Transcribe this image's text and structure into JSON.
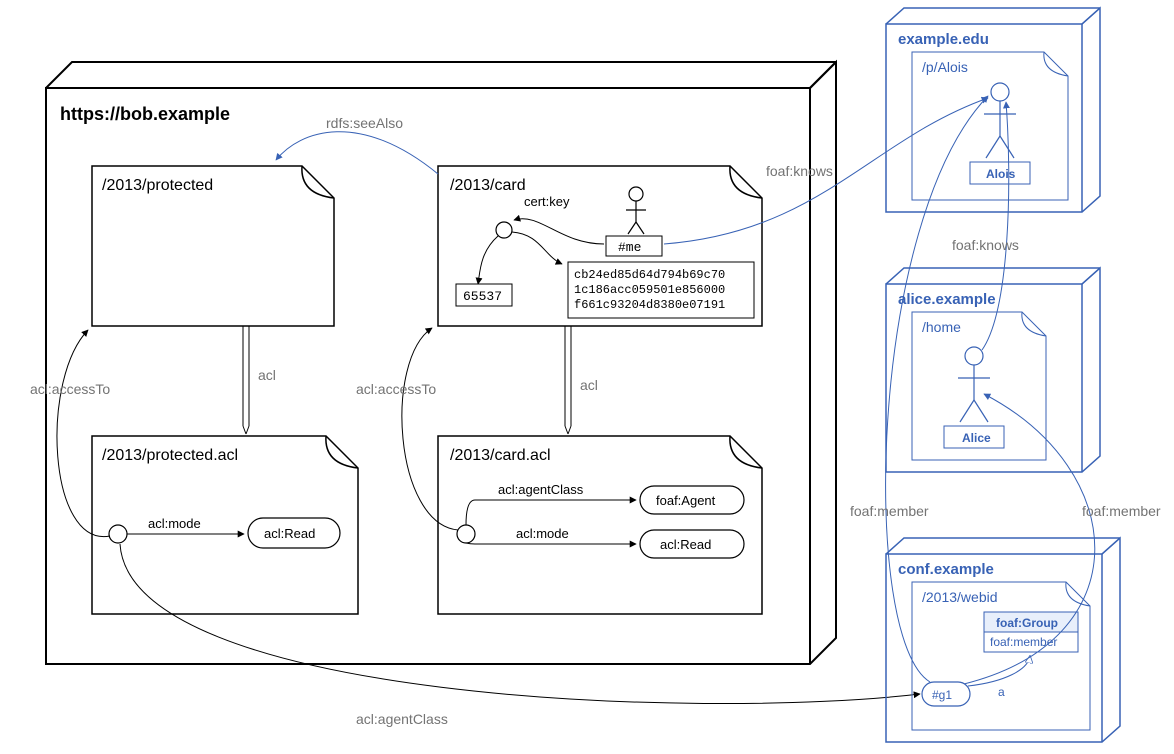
{
  "main_box": {
    "title": "https://bob.example",
    "docs": {
      "protected": {
        "title": "/2013/protected"
      },
      "protected_acl": {
        "title": "/2013/protected.acl"
      },
      "card": {
        "title": "/2013/card"
      },
      "card_acl": {
        "title": "/2013/card.acl"
      }
    },
    "card": {
      "cert_key_label": "cert:key",
      "me_label": "#me",
      "exponent": "65537",
      "modulus_lines": [
        "cb24ed85d64d794b69c70",
        "1c186acc059501e856000",
        "f661c93204d8380e07191"
      ]
    },
    "protected_acl": {
      "mode_label": "acl:mode",
      "read_label": "acl:Read"
    },
    "card_acl": {
      "agentclass_label": "acl:agentClass",
      "agent_label": "foaf:Agent",
      "mode_label": "acl:mode",
      "read_label": "acl:Read"
    },
    "edges": {
      "seeAlso": "rdfs:seeAlso",
      "acl_left": "acl",
      "acl_right": "acl",
      "accessTo_left": "acl:accessTo",
      "accessTo_right": "acl:accessTo",
      "agentClass_out": "acl:agentClass"
    }
  },
  "external": {
    "edu": {
      "server_label": "example.edu",
      "doc_title": "/p/Alois",
      "person_name": "Alois"
    },
    "alice": {
      "server_label": "alice.example",
      "doc_title": "/home",
      "person_name": "Alice"
    },
    "conf": {
      "server_label": "conf.example",
      "doc_title": "/2013/webid",
      "group_type": "foaf:Group",
      "group_member_label": "foaf:member",
      "a_label": "a",
      "g1_label": "#g1"
    },
    "edges": {
      "knows_top": "foaf:knows",
      "knows_mid": "foaf:knows",
      "member_left": "foaf:member",
      "member_right": "foaf:member"
    }
  }
}
